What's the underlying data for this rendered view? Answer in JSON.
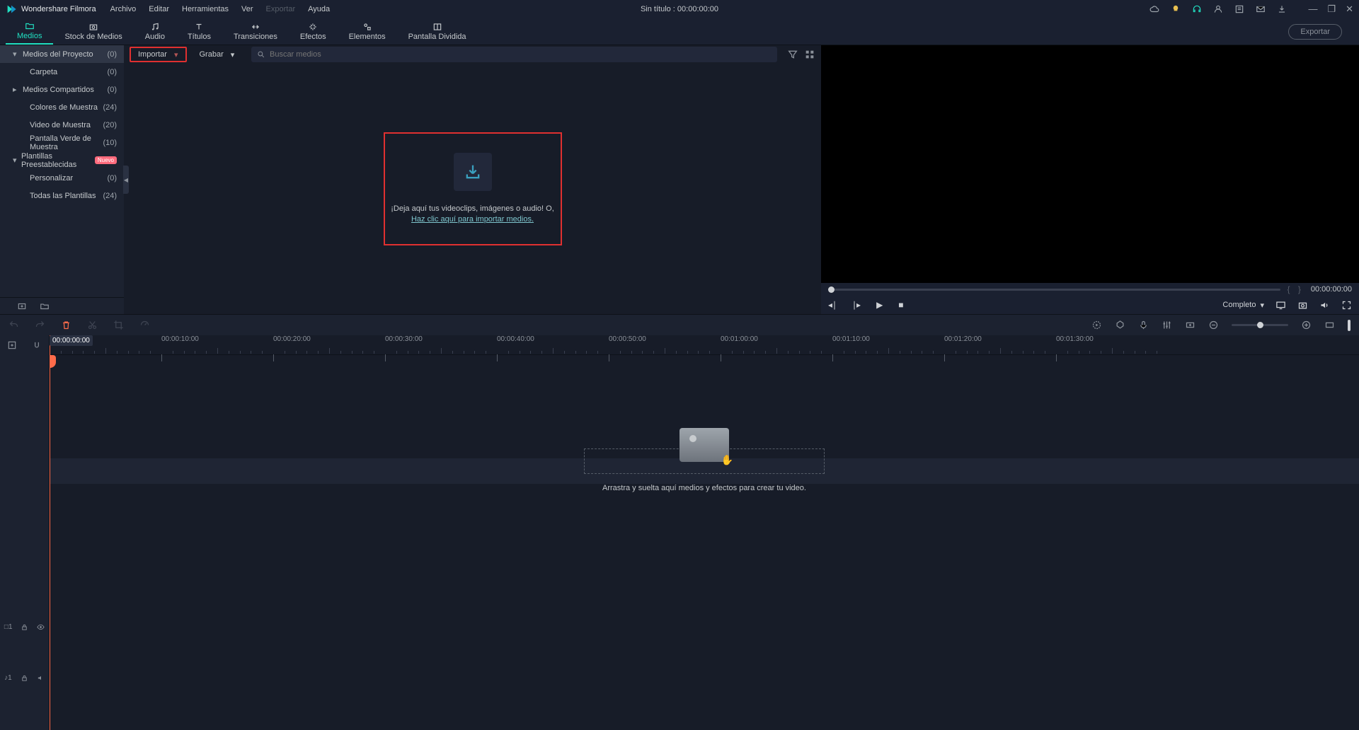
{
  "app": {
    "name": "Wondershare Filmora"
  },
  "menu": [
    "Archivo",
    "Editar",
    "Herramientas",
    "Ver",
    "Exportar",
    "Ayuda"
  ],
  "menu_muted_index": 4,
  "title_center": "Sin título : 00:00:00:00",
  "tabs": [
    {
      "label": "Medios",
      "icon": "folder"
    },
    {
      "label": "Stock de Medios",
      "icon": "camera"
    },
    {
      "label": "Audio",
      "icon": "music"
    },
    {
      "label": "Títulos",
      "icon": "text"
    },
    {
      "label": "Transiciones",
      "icon": "transition"
    },
    {
      "label": "Efectos",
      "icon": "sparkle"
    },
    {
      "label": "Elementos",
      "icon": "shapes"
    },
    {
      "label": "Pantalla Dividida",
      "icon": "split"
    }
  ],
  "active_tab": 0,
  "export_label": "Exportar",
  "sidebar": [
    {
      "label": "Medios del Proyecto",
      "count": "(0)",
      "level": 1,
      "expand": "down",
      "active": true
    },
    {
      "label": "Carpeta",
      "count": "(0)",
      "level": 2
    },
    {
      "label": "Medios Compartidos",
      "count": "(0)",
      "level": 1,
      "expand": "right"
    },
    {
      "label": "Colores de Muestra",
      "count": "(24)",
      "level": 2
    },
    {
      "label": "Video de Muestra",
      "count": "(20)",
      "level": 2
    },
    {
      "label": "Pantalla Verde de Muestra",
      "count": "(10)",
      "level": 2
    },
    {
      "label": "Plantillas Preestablecidas",
      "count": "",
      "level": 1,
      "expand": "down",
      "badge": "Nuevo"
    },
    {
      "label": "Personalizar",
      "count": "(0)",
      "level": 2
    },
    {
      "label": "Todas las Plantillas",
      "count": "(24)",
      "level": 2
    }
  ],
  "media_toolbar": {
    "import": "Importar",
    "record": "Grabar",
    "search_placeholder": "Buscar medios"
  },
  "drop_zone": {
    "line1": "¡Deja aquí tus videoclips, imágenes o audio!  O,",
    "link": "Haz clic aquí para importar medios."
  },
  "preview": {
    "time": "00:00:00:00",
    "quality": "Completo"
  },
  "ruler": {
    "labels": [
      "00:00:00:00",
      "00:00:10:00",
      "00:00:20:00",
      "00:00:30:00",
      "00:00:40:00",
      "00:00:50:00",
      "00:01:00:00",
      "00:01:10:00",
      "00:01:20:00",
      "00:01:30:00"
    ],
    "spacing_px": 158
  },
  "timeline_drop": "Arrastra y suelta aquí medios y efectos para crear tu video.",
  "track_labels": {
    "video": "1",
    "audio": "1"
  },
  "colors": {
    "accent": "#21e0c2",
    "highlight": "#e03030",
    "playhead": "#ff6b4a"
  }
}
